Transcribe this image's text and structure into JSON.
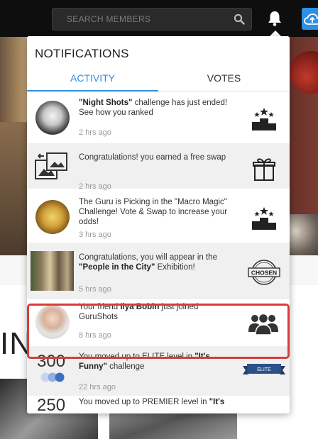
{
  "search": {
    "placeholder": "SEARCH MEMBERS",
    "icon": "search-icon"
  },
  "topbar": {
    "bell_icon": "bell-icon",
    "upload_icon": "cloud-upload-icon",
    "accent_color": "#2f8fe0"
  },
  "background": {
    "big_text": "IN"
  },
  "notifications": {
    "title": "NOTIFICATIONS",
    "tabs": [
      {
        "label": "ACTIVITY",
        "active": true
      },
      {
        "label": "VOTES",
        "active": false
      }
    ],
    "items": [
      {
        "bold": "\"Night Shots\"",
        "text_after": " challenge has just ended! See how you ranked",
        "time": "2 hrs ago",
        "icon": "podium-icon"
      },
      {
        "text": "Congratulations! you earned a free swap",
        "time": "2 hrs ago",
        "icon": "gift-icon"
      },
      {
        "text": "The Guru is Picking in the \"Macro Magic\" Challenge! Vote & Swap to increase your odds!",
        "time": "3 hrs ago",
        "icon": "podium-icon"
      },
      {
        "text_before": "Congratulations, you will appear in the ",
        "bold": "\"People in the City\"",
        "text_after": " Exhibition!",
        "time": "5 hrs ago",
        "icon": "chosen-stamp-icon",
        "badge_text": "CHOSEN"
      },
      {
        "text_before": "Your friend ",
        "bold": "Ilya Bobin",
        "text_after": " just joined GuruShots",
        "time": "8 hrs ago",
        "icon": "group-icon"
      },
      {
        "number": "300",
        "text_before": "You moved up to ELITE level in ",
        "bold": "\"It's Funny\"",
        "text_after": " challenge",
        "time": "22 hrs ago",
        "icon": "level-ribbon-icon",
        "badge_text": "ELITE"
      },
      {
        "number": "250",
        "text_before": "You moved up to PREMIER level in ",
        "bold": "\"It's",
        "text_after": "",
        "time": "",
        "icon": "level-ribbon-icon"
      }
    ],
    "highlight_color": "#d93b3b"
  }
}
